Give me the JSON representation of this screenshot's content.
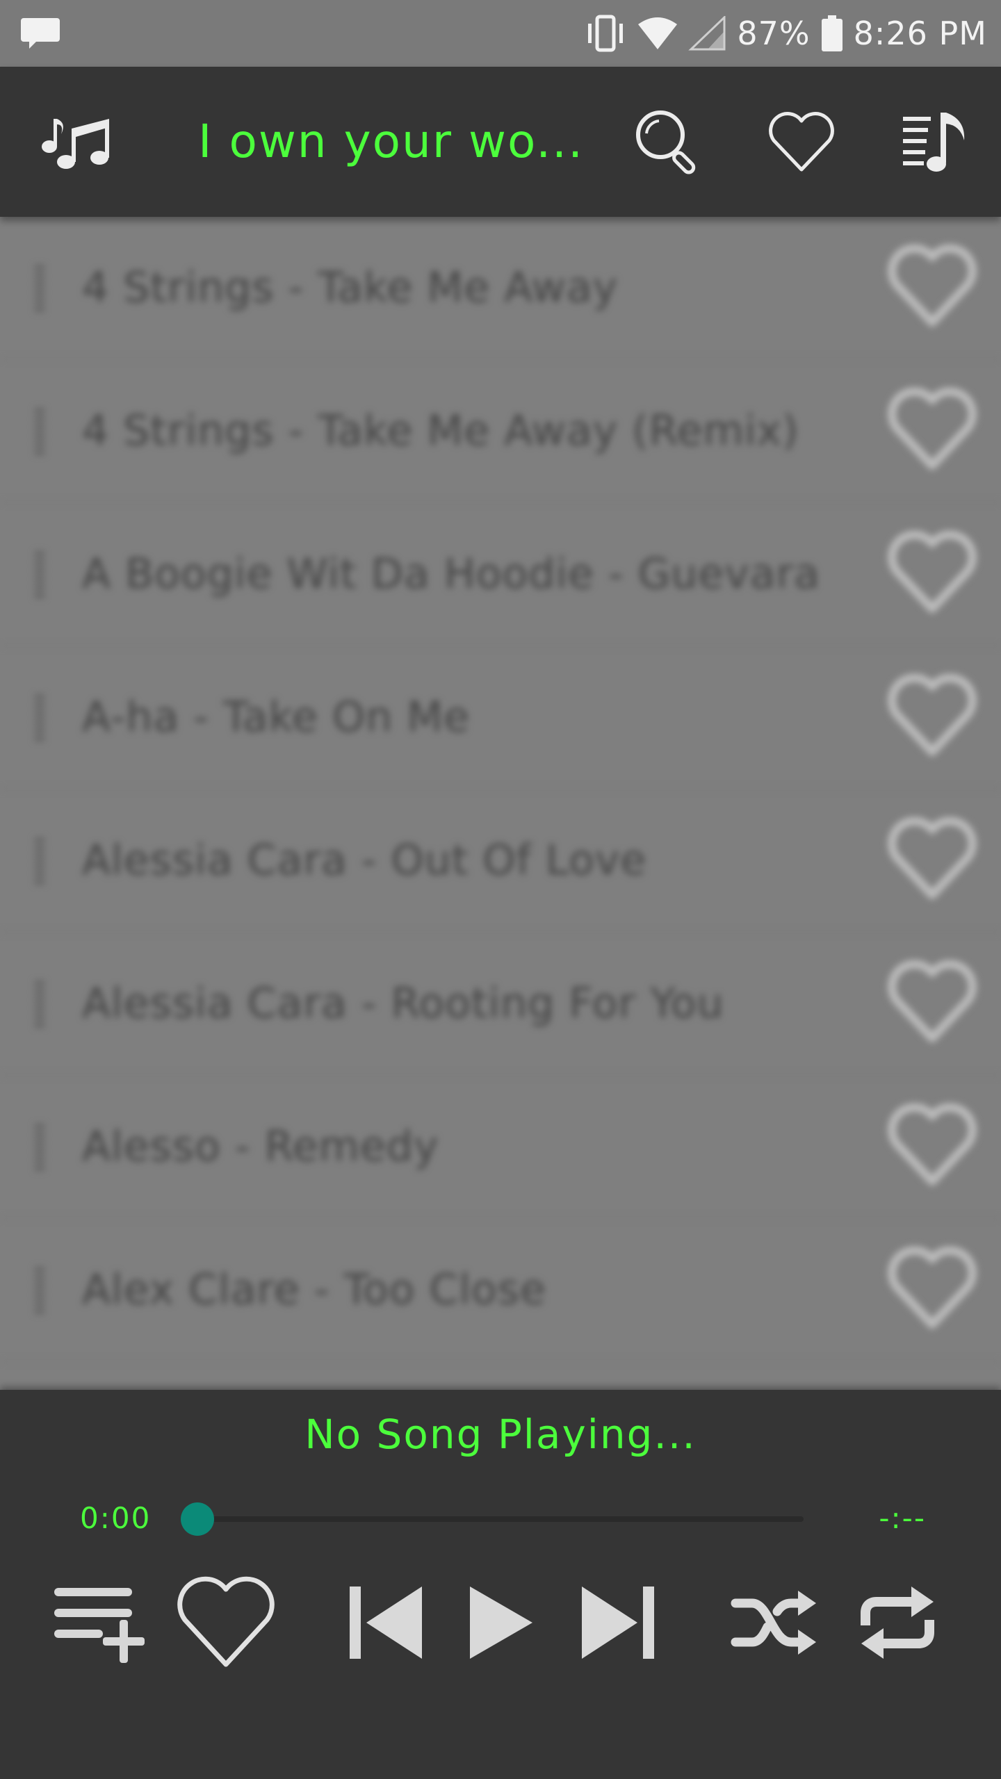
{
  "status_bar": {
    "battery_percent": "87%",
    "time": "8:26 PM",
    "icons": [
      "message-icon",
      "vibrate-icon",
      "wifi-icon",
      "signal-icon",
      "battery-icon"
    ]
  },
  "toolbar": {
    "title": "I own your wo...",
    "icons": [
      "music-notes-icon",
      "search-icon",
      "favorite-icon",
      "playlist-icon"
    ]
  },
  "songs": [
    {
      "title": "4 Strings - Take Me Away"
    },
    {
      "title": "4 Strings - Take Me Away (Remix)"
    },
    {
      "title": "A Boogie Wit Da Hoodie - Guevara"
    },
    {
      "title": "A-ha - Take On Me"
    },
    {
      "title": "Alessia Cara - Out Of Love"
    },
    {
      "title": "Alessia Cara - Rooting For You"
    },
    {
      "title": "Alesso - Remedy"
    },
    {
      "title": "Alex Clare - Too Close"
    }
  ],
  "player": {
    "now_playing": "No Song Playing...",
    "current_time": "0:00",
    "total_time": "-:--",
    "progress": 0,
    "controls": [
      "add-to-queue-icon",
      "favorite-icon",
      "previous-icon",
      "play-icon",
      "next-icon",
      "shuffle-icon",
      "repeat-icon"
    ]
  },
  "colors": {
    "accent_green": "#4cff3c",
    "seek_teal": "#0b8a78",
    "toolbar_bg": "#353535"
  }
}
